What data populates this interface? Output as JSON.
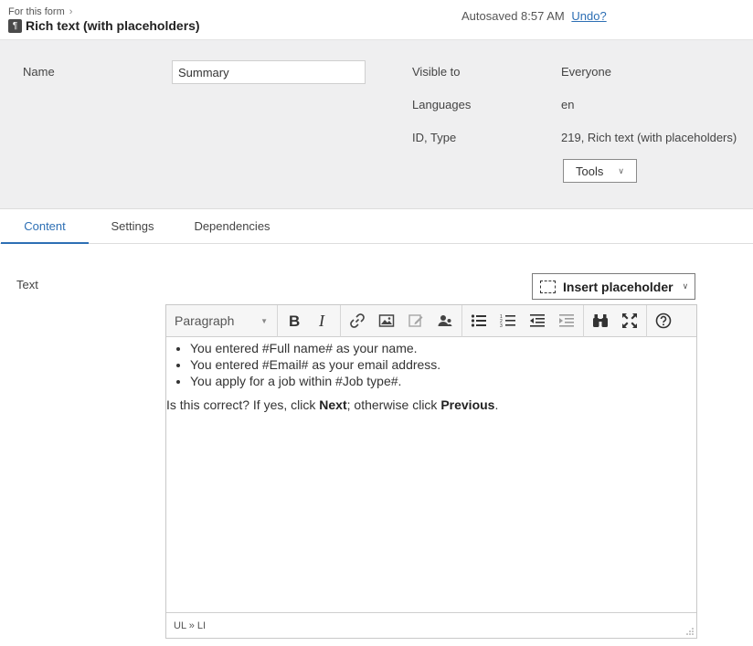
{
  "header": {
    "breadcrumb": "For this form",
    "type_icon": "paragraph-icon",
    "title": "Rich text (with placeholders)",
    "autosave_text": "Autosaved 8:57 AM",
    "undo_label": "Undo?"
  },
  "properties": {
    "name_label": "Name",
    "name_value": "Summary",
    "visible_label": "Visible to",
    "visible_value": "Everyone",
    "languages_label": "Languages",
    "languages_value": "en",
    "idtype_label": "ID, Type",
    "idtype_value": "219, Rich text (with placeholders)",
    "tools_label": "Tools"
  },
  "tabs": [
    {
      "label": "Content",
      "active": true
    },
    {
      "label": "Settings",
      "active": false
    },
    {
      "label": "Dependencies",
      "active": false
    }
  ],
  "content": {
    "text_label": "Text",
    "insert_placeholder_label": "Insert placeholder"
  },
  "editor": {
    "format_select": "Paragraph",
    "toolbar_icons": [
      "bold-icon",
      "italic-icon",
      "link-icon",
      "image-icon",
      "edit-icon",
      "person-icon",
      "bulleted-list-icon",
      "numbered-list-icon",
      "outdent-icon",
      "indent-icon",
      "find-icon",
      "fullscreen-icon",
      "help-icon"
    ],
    "list_items": [
      "You entered #Full name# as your name.",
      "You entered #Email# as your email address.",
      "You apply for a job within #Job type#."
    ],
    "paragraph": {
      "part1": "Is this correct? If yes, click ",
      "bold1": "Next",
      "part2": "; otherwise click ",
      "bold2": "Previous",
      "part3": "."
    },
    "status_path": "UL » LI"
  },
  "colors": {
    "accent": "#2d6fb4",
    "panel_bg": "#efeff0"
  }
}
